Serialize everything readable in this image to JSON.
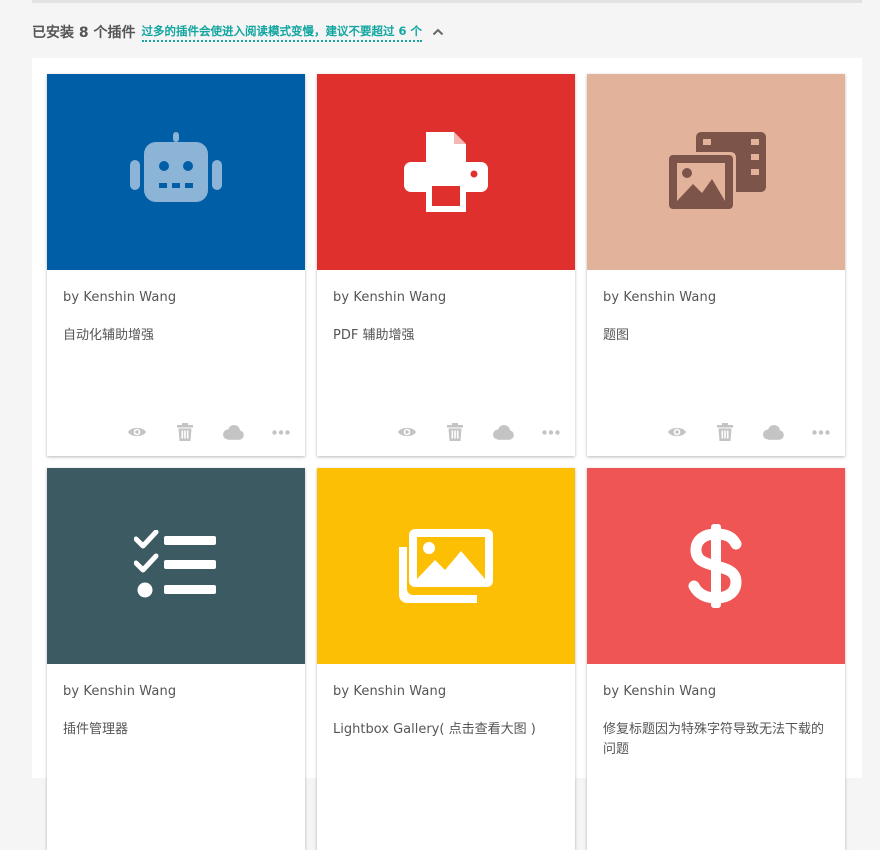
{
  "header": {
    "installed_text": "已安装 8 个插件",
    "warning_text": "过多的插件会使进入阅读模式变慢，建议不要超过 6 个"
  },
  "plugins": [
    {
      "author": "by Kenshin Wang",
      "desc": "自动化辅助增强",
      "color": "#005ea7",
      "icon": "robot-icon"
    },
    {
      "author": "by Kenshin Wang",
      "desc": "PDF 辅助增强",
      "color": "#e0302e",
      "icon": "printer-icon"
    },
    {
      "author": "by Kenshin Wang",
      "desc": "题图",
      "color": "#e3b29a",
      "icon": "media-images-icon"
    },
    {
      "author": "by Kenshin Wang",
      "desc": "插件管理器",
      "color": "#3b5a62",
      "icon": "checklist-icon"
    },
    {
      "author": "by Kenshin Wang",
      "desc": "Lightbox Gallery( 点击查看大图 )",
      "color": "#fdbf04",
      "icon": "gallery-icon"
    },
    {
      "author": "by Kenshin Wang",
      "desc": "修复标题因为特殊字符导致无法下载的问题",
      "color": "#ef5554",
      "icon": "dollar-icon"
    }
  ]
}
